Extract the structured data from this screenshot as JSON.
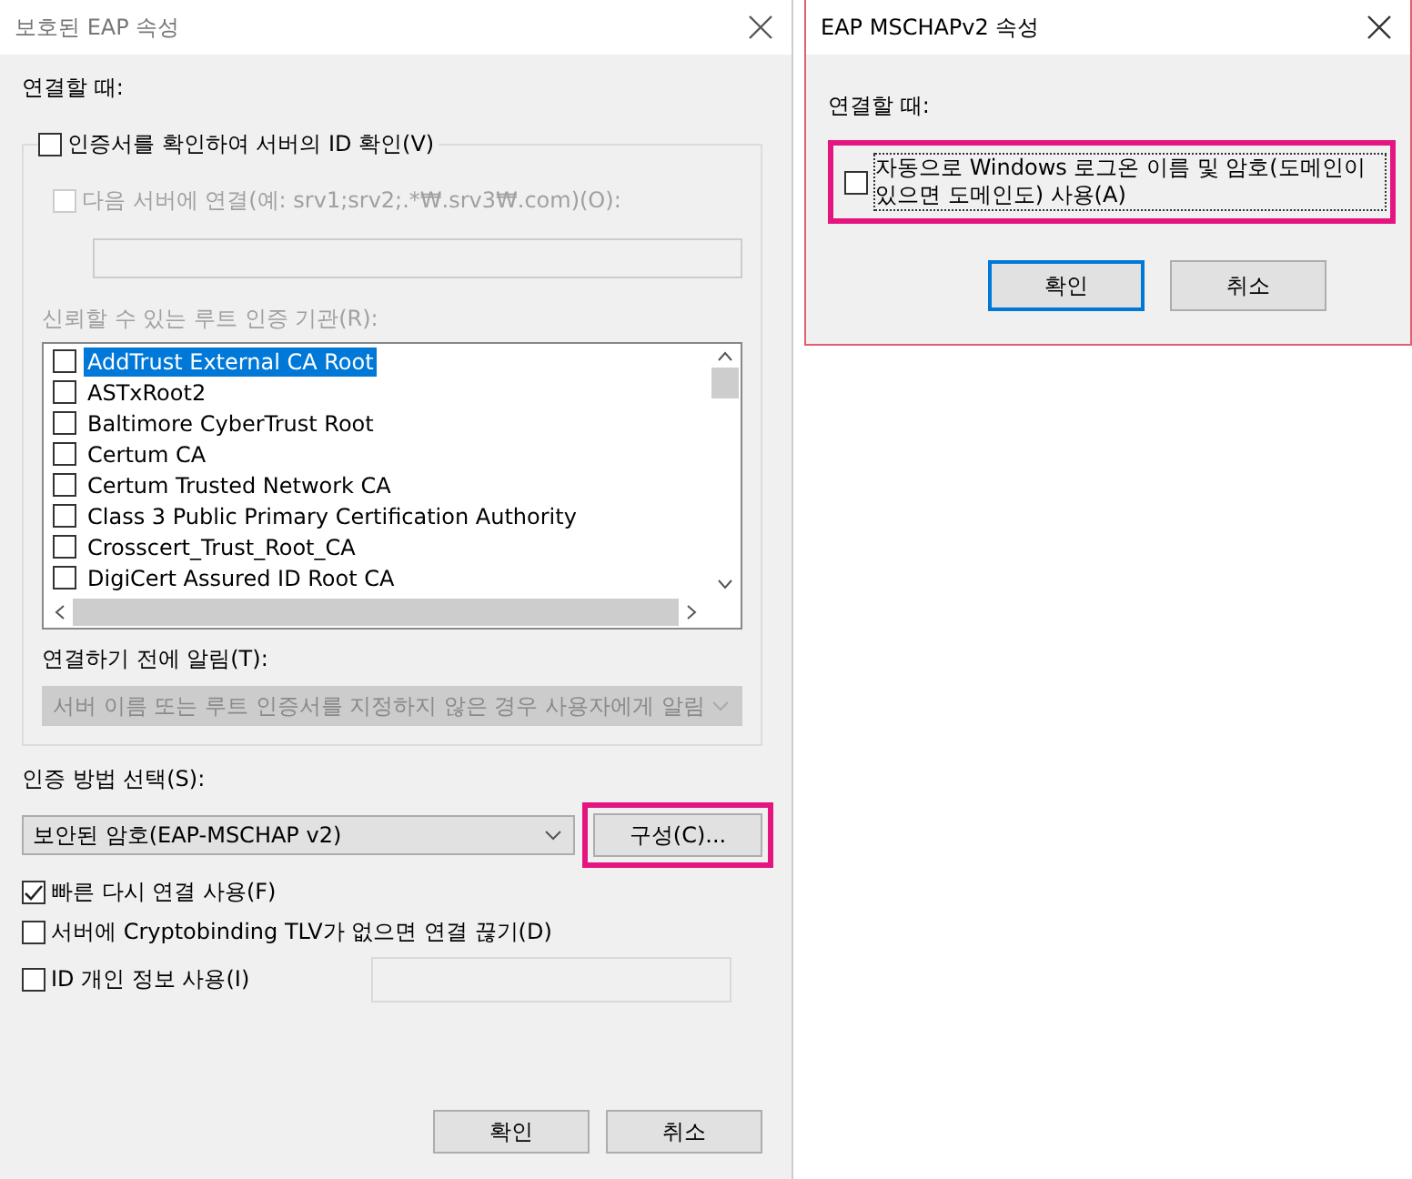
{
  "protected_eap": {
    "title": "보호된 EAP 속성",
    "connect_label": "연결할 때:",
    "verify_server": {
      "label": "인증서를 확인하여 서버의 ID 확인(V)",
      "checked": false
    },
    "connect_servers": {
      "label": "다음 서버에 연결(예: srv1;srv2;.*₩.srv3₩.com)(O):",
      "checked": false,
      "disabled": true
    },
    "trusted_roots": {
      "label": "신뢰할 수 있는 루트 인증 기관(R):",
      "disabled": true,
      "items": [
        {
          "label": "AddTrust External CA Root",
          "checked": false,
          "selected": true
        },
        {
          "label": "ASTxRoot2",
          "checked": false,
          "selected": false
        },
        {
          "label": "Baltimore CyberTrust Root",
          "checked": false,
          "selected": false
        },
        {
          "label": "Certum CA",
          "checked": false,
          "selected": false
        },
        {
          "label": "Certum Trusted Network CA",
          "checked": false,
          "selected": false
        },
        {
          "label": "Class 3 Public Primary Certification Authority",
          "checked": false,
          "selected": false
        },
        {
          "label": "Crosscert_Trust_Root_CA",
          "checked": false,
          "selected": false
        },
        {
          "label": "DigiCert Assured ID Root CA",
          "checked": false,
          "selected": false
        }
      ]
    },
    "notify": {
      "label": "연결하기 전에 알림(T):",
      "value": "서버 이름 또는 루트 인증서를 지정하지 않은 경우 사용자에게 알림",
      "disabled": true
    },
    "auth_method": {
      "label": "인증 방법 선택(S):",
      "value": "보안된 암호(EAP-MSCHAP v2)"
    },
    "configure_button": {
      "label": "구성(C)...",
      "highlighted": true
    },
    "options": [
      {
        "kind": "checkbox",
        "label": "빠른 다시 연결 사용(F)",
        "checked": true
      },
      {
        "kind": "checkbox",
        "label": "서버에 Cryptobinding TLV가 없으면 연결 끊기(D)",
        "checked": false
      },
      {
        "kind": "checkbox_field",
        "label": "ID 개인 정보 사용(I)",
        "checked": false
      }
    ],
    "buttons": [
      {
        "label": "확인"
      },
      {
        "label": "취소"
      }
    ]
  },
  "mschap": {
    "title": "EAP MSCHAPv2 속성",
    "connect_label": "연결할 때:",
    "auto_logon": {
      "label": "자동으로 Windows 로그온 이름 및 암호(도메인이 있으면 도메인도) 사용(A)",
      "checked": false,
      "highlighted": true
    },
    "buttons": [
      {
        "label": "확인",
        "default": true
      },
      {
        "label": "취소",
        "default": false
      }
    ]
  }
}
